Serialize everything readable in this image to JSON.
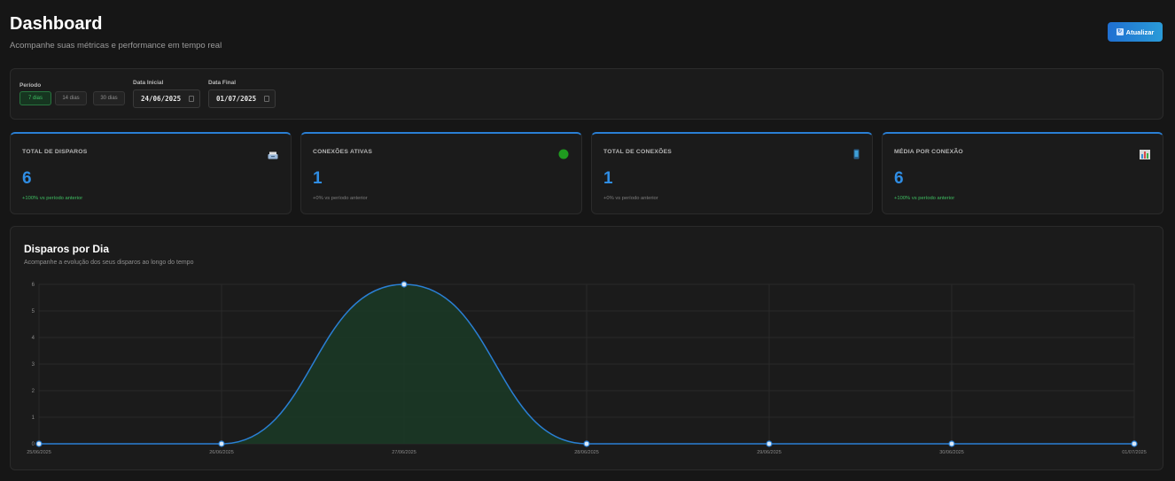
{
  "header": {
    "title": "Dashboard",
    "subtitle": "Acompanhe suas métricas e performance em tempo real",
    "refresh_label": "Atualizar",
    "refresh_icon": "refresh-icon"
  },
  "filters": {
    "period_label": "Período",
    "periods": [
      "7 dias",
      "14 dias",
      "30 dias"
    ],
    "active_period": "7 dias",
    "start_label": "Data Inicial",
    "start_value": "24/06/2025",
    "end_label": "Data Final",
    "end_value": "01/07/2025"
  },
  "stats": [
    {
      "title": "TOTAL DE DISPAROS",
      "value": "6",
      "change": "+100% vs período anterior",
      "icon": "inbox-icon",
      "positive": true
    },
    {
      "title": "CONEXÕES ATIVAS",
      "value": "1",
      "change": "+0% vs período anterior",
      "icon": "green-circle-icon",
      "positive": false
    },
    {
      "title": "TOTAL DE CONEXÕES",
      "value": "1",
      "change": "+0% vs período anterior",
      "icon": "phone-icon",
      "positive": false
    },
    {
      "title": "MÉDIA POR CONEXÃO",
      "value": "6",
      "change": "+100% vs período anterior",
      "icon": "bar-chart-icon",
      "positive": true
    }
  ],
  "colors": {
    "accent": "#2a7fd4",
    "value": "#2f8de4",
    "positive": "#3fbf62",
    "active_green": "#1f9a1f"
  },
  "chart_section": {
    "title": "Disparos por Dia",
    "subtitle": "Acompanhe a evolução dos seus disparos ao longo do tempo"
  },
  "chart_data": {
    "type": "area",
    "categories": [
      "25/06/2025",
      "26/06/2025",
      "27/06/2025",
      "28/06/2025",
      "29/06/2025",
      "30/06/2025",
      "01/07/2025"
    ],
    "values": [
      0,
      0,
      6,
      0,
      0,
      0,
      0
    ],
    "ylim": [
      0,
      6
    ],
    "yticks": [
      0,
      1,
      2,
      3,
      4,
      5,
      6
    ],
    "grid": true,
    "line_color": "#2a7fd4",
    "fill_color": "#1a3a26"
  }
}
